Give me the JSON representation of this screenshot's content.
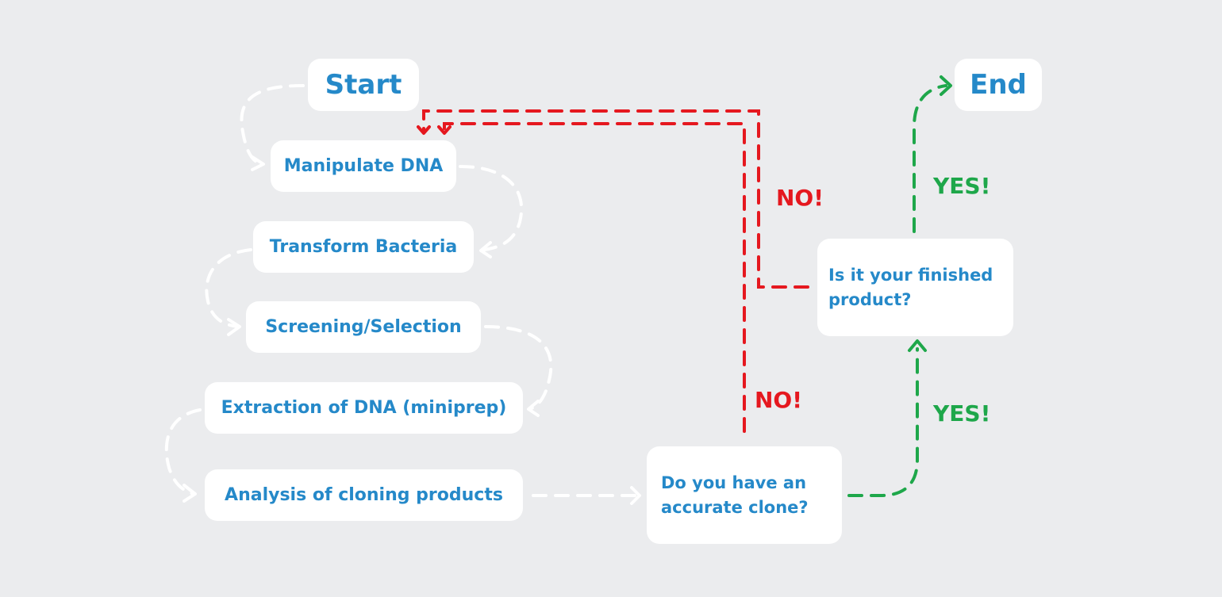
{
  "colors": {
    "background": "#ebecee",
    "box": "#ffffff",
    "text": "#2589c9",
    "no": "#e5181f",
    "yes": "#1ea74a",
    "flow": "#ffffff"
  },
  "nodes": {
    "start": "Start",
    "end": "End",
    "steps": [
      "Manipulate DNA",
      "Transform Bacteria",
      "Screening/Selection",
      "Extraction of DNA (miniprep)",
      "Analysis of cloning products"
    ],
    "question_clone": "Do you have an\naccurate clone?",
    "question_finished": "Is it your finished\nproduct?"
  },
  "edge_labels": {
    "no_top": "NO!",
    "no_bottom": "NO!",
    "yes_top": "YES!",
    "yes_bottom": "YES!"
  }
}
